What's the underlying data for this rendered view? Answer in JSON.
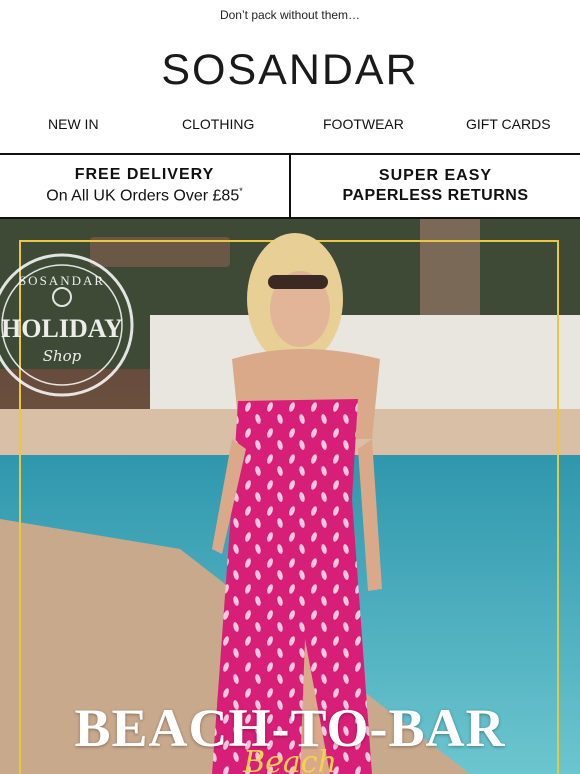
{
  "preheader": "Don’t pack without them…",
  "brand": {
    "name": "SOSANDAR"
  },
  "nav": [
    {
      "label": "NEW IN"
    },
    {
      "label": "CLOTHING"
    },
    {
      "label": "FOOTWEAR"
    },
    {
      "label": "GIFT CARDS"
    }
  ],
  "promo": {
    "delivery": {
      "line1": "FREE DELIVERY",
      "line2": "On All UK Orders Over £85",
      "footnote": "*"
    },
    "returns": {
      "line1": "SUPER EASY",
      "line2": "PAPERLESS RETURNS"
    }
  },
  "hero": {
    "title": "BEACH-TO-BAR",
    "script": "Beach",
    "badge": {
      "top": "SOSANDAR",
      "middle": "HOLIDAY",
      "bottom": "Shop"
    },
    "colors": {
      "frame": "#e9c840",
      "pool": "#4fb8c8",
      "dress": "#d81f78"
    }
  }
}
